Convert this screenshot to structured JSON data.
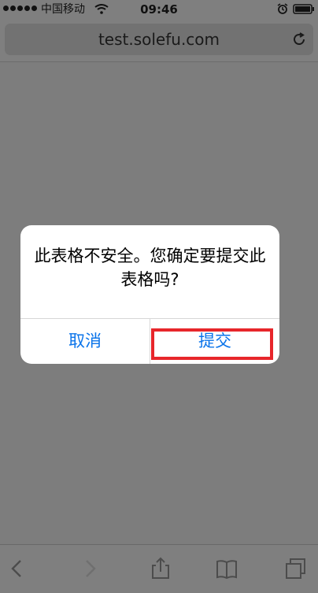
{
  "status_bar": {
    "carrier": "中国移动",
    "time": "09:46"
  },
  "address_bar": {
    "url": "test.solefu.com"
  },
  "dialog": {
    "message": "此表格不安全。您确定要提交此表格吗?",
    "cancel_label": "取消",
    "submit_label": "提交"
  },
  "toolbar": {
    "icons": [
      "back-icon",
      "forward-icon",
      "share-icon",
      "bookmarks-icon",
      "tabs-icon"
    ]
  },
  "colors": {
    "overlay": "#7d7d7d",
    "dialog_background": "#ffffff",
    "button_blue": "#0b74ea",
    "highlight_red": "#e7262b"
  }
}
